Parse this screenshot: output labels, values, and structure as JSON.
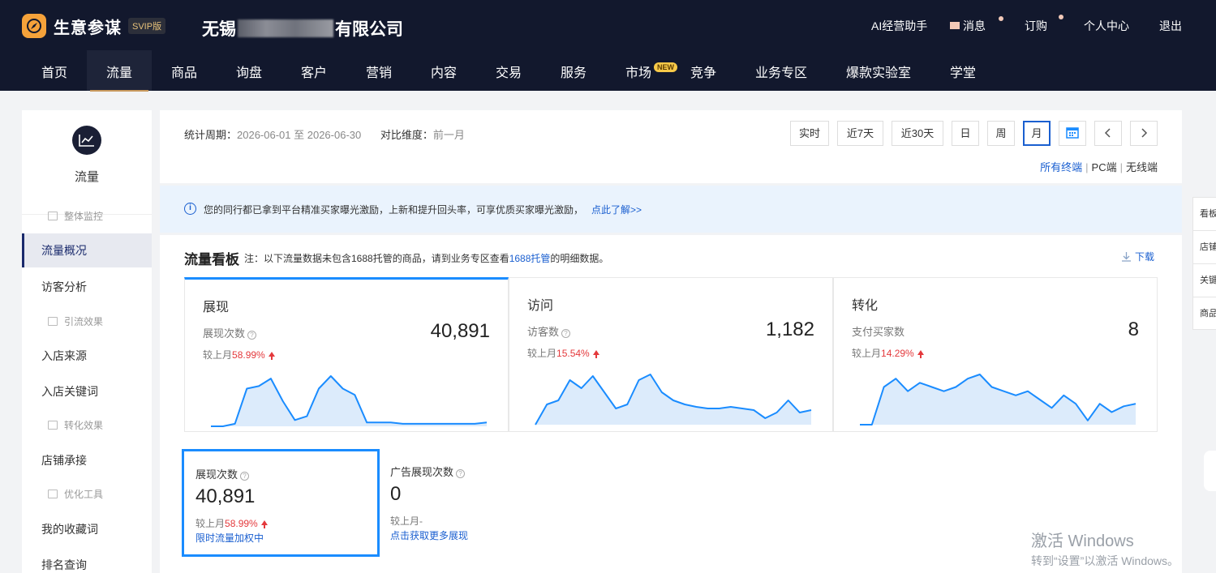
{
  "header": {
    "brand": "生意参谋",
    "badge": "SVIP版",
    "company_prefix": "无锡",
    "company_suffix": "有限公司",
    "top_links": [
      {
        "label": "AI经营助手"
      },
      {
        "label": "消息"
      },
      {
        "label": "订购"
      },
      {
        "label": "个人中心"
      },
      {
        "label": "退出"
      }
    ],
    "nav": [
      "首页",
      "流量",
      "商品",
      "询盘",
      "客户",
      "营销",
      "内容",
      "交易",
      "服务",
      "市场",
      "竞争",
      "业务专区",
      "爆款实验室",
      "学堂"
    ],
    "nav_active": "流量",
    "new_badge": "NEW"
  },
  "sidebar": {
    "title": "流量",
    "items": [
      {
        "label": "整体监控",
        "type": "group"
      },
      {
        "label": "流量概况",
        "type": "item",
        "active": true
      },
      {
        "label": "访客分析",
        "type": "item"
      },
      {
        "label": "引流效果",
        "type": "group"
      },
      {
        "label": "入店来源",
        "type": "item"
      },
      {
        "label": "入店关键词",
        "type": "item"
      },
      {
        "label": "转化效果",
        "type": "group"
      },
      {
        "label": "店铺承接",
        "type": "item"
      },
      {
        "label": "优化工具",
        "type": "group"
      },
      {
        "label": "我的收藏词",
        "type": "item"
      },
      {
        "label": "排名查询",
        "type": "item"
      }
    ]
  },
  "toolbar": {
    "period_label": "统计周期：",
    "period_value": "2026-06-01 至 2026-06-30",
    "compare_label": "对比维度：",
    "compare_value": "前一月",
    "buttons": [
      "实时",
      "近7天",
      "近30天",
      "日",
      "周",
      "月"
    ],
    "active_button": "月",
    "terminals": [
      "所有终端",
      "PC端",
      "无线端"
    ]
  },
  "notice": {
    "text": "您的同行都已拿到平台精准买家曝光激励，上新和提升回头率，可享优质买家曝光激励，",
    "link": "点此了解>>"
  },
  "board": {
    "title": "流量看板",
    "note_prefix": "注：以下流量数据未包含1688托管的商品，请到业务专区查看",
    "note_link": "1688托管",
    "note_suffix": "的明细数据。",
    "download": "下载",
    "metrics": [
      {
        "title": "展现",
        "label": "展现次数",
        "value": "40,891",
        "compare_prefix": "较上月",
        "compare_pct": "58.99%",
        "series": [
          0,
          0,
          2,
          30,
          32,
          38,
          20,
          5,
          8,
          30,
          40,
          30,
          25,
          3,
          3,
          3,
          2,
          2,
          2,
          2,
          2,
          2,
          2,
          3
        ]
      },
      {
        "title": "访问",
        "label": "访客数",
        "value": "1,182",
        "compare_prefix": "较上月",
        "compare_pct": "15.54%",
        "series": [
          0,
          25,
          30,
          55,
          45,
          60,
          40,
          20,
          25,
          55,
          62,
          40,
          30,
          25,
          22,
          20,
          20,
          22,
          20,
          18,
          8,
          15,
          30,
          15,
          18
        ]
      },
      {
        "title": "转化",
        "label": "支付买家数",
        "value": "8",
        "compare_prefix": "较上月",
        "compare_pct": "14.29%",
        "series": [
          0,
          0,
          45,
          55,
          40,
          50,
          45,
          40,
          45,
          55,
          60,
          45,
          40,
          35,
          40,
          30,
          20,
          35,
          25,
          5,
          25,
          15,
          22,
          25
        ]
      }
    ],
    "sub_cards": [
      {
        "label": "展现次数",
        "value": "40,891",
        "compare_prefix": "较上月",
        "compare_pct": "58.99%",
        "link": "限时流量加权中"
      },
      {
        "label": "广告展现次数",
        "value": "0",
        "compare_prefix": "较上月",
        "compare_pct": "-",
        "link": "点击获取更多展现"
      }
    ]
  },
  "side_float": [
    "看板",
    "店铺",
    "关键词",
    "商品"
  ],
  "watermark": {
    "line1": "激活 Windows",
    "line2": "转到“设置”以激活 Windows。"
  },
  "colors": {
    "accent": "#1a8cff",
    "link": "#1a5fd0",
    "up": "#e4393c",
    "header_bg": "#12182d",
    "gold": "#c99a5e"
  }
}
